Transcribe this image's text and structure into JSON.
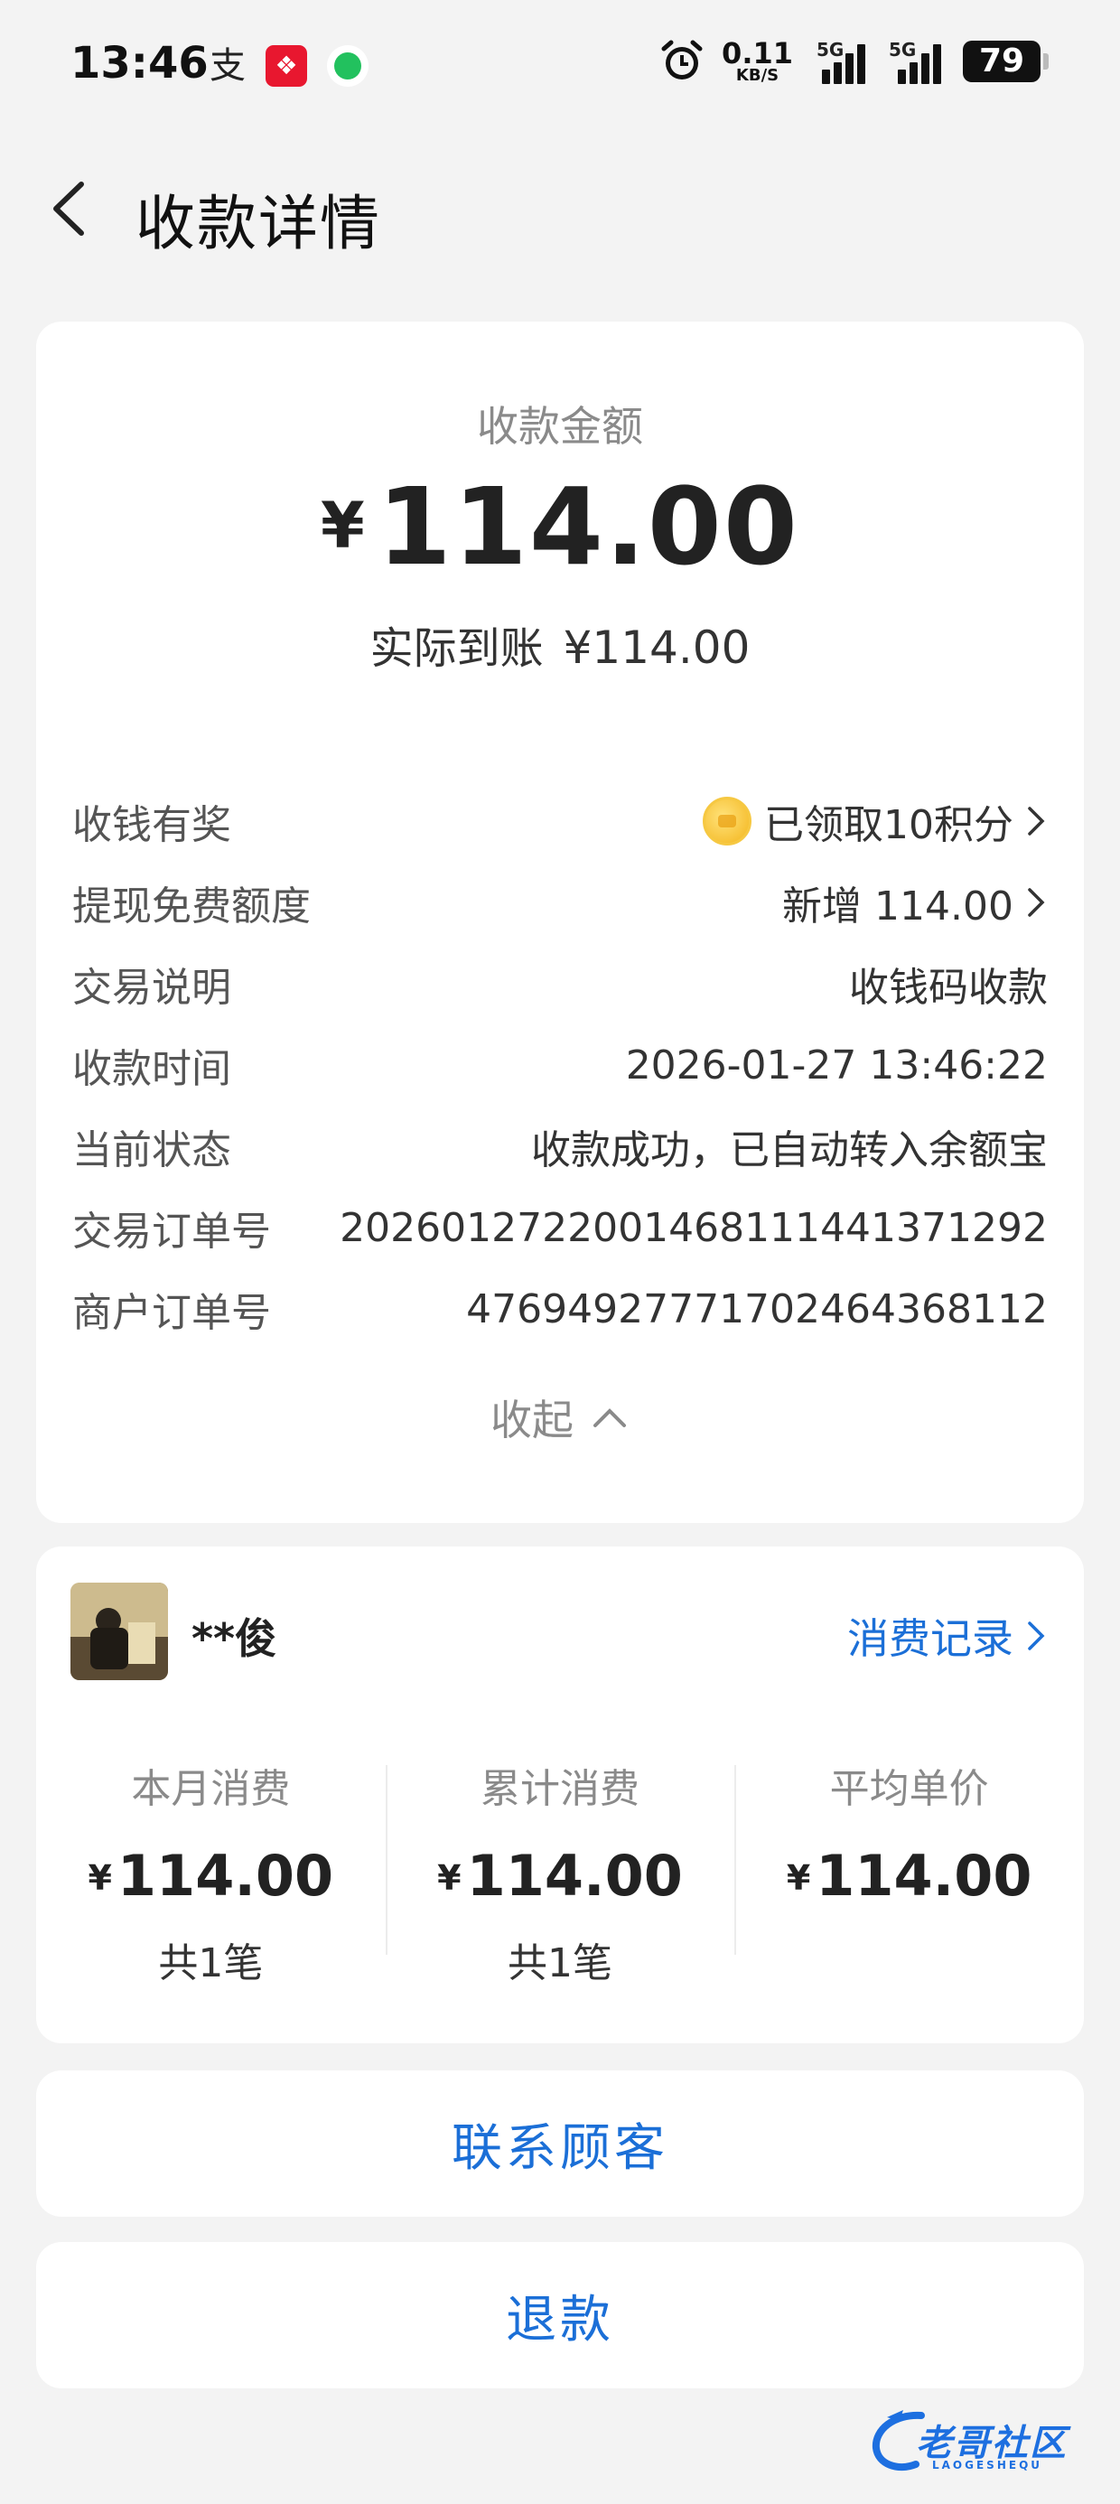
{
  "status_bar": {
    "time": "13:46",
    "net_speed_value": "0.11",
    "net_speed_unit": "KB/S",
    "network_1": "5G",
    "network_2": "5G",
    "battery": "79",
    "icons": [
      "alipay-icon",
      "red-app-icon",
      "green-app-icon",
      "alarm-icon",
      "signal-icon",
      "battery-icon"
    ]
  },
  "header": {
    "title": "收款详情"
  },
  "amount": {
    "label": "收款金额",
    "currency": "¥",
    "value": "114.00",
    "actual_label": "实际到账",
    "actual_value": "¥114.00"
  },
  "details": {
    "rows": [
      {
        "label": "收钱有奖",
        "value": "已领取10积分"
      },
      {
        "label": "提现免费额度",
        "value": "新增 114.00"
      },
      {
        "label": "交易说明",
        "value": "收钱码收款"
      },
      {
        "label": "收款时间",
        "value": "2026-01-27 13:46:22"
      },
      {
        "label": "当前状态",
        "value": "收款成功，已自动转入余额宝"
      },
      {
        "label": "交易订单号",
        "value": "2026012722001468111441371292"
      },
      {
        "label": "商户订单号",
        "value": "476949277717024643681​12"
      }
    ],
    "collapse_label": "收起"
  },
  "customer": {
    "name": "**俊",
    "record_link": "消费记录",
    "stats": [
      {
        "label": "本月消费",
        "currency": "¥",
        "value": "114.00",
        "count": "共1笔"
      },
      {
        "label": "累计消费",
        "currency": "¥",
        "value": "114.00",
        "count": "共1笔"
      },
      {
        "label": "平均单价",
        "currency": "¥",
        "value": "114.00",
        "count": ""
      }
    ]
  },
  "actions": {
    "contact_label": "联系顾客",
    "refund_label": "退款"
  },
  "watermark": {
    "text": "老哥社区",
    "sub": "LAOGESHEQU"
  },
  "colors": {
    "link_blue": "#1b6fd7",
    "background": "#f3f3f3"
  }
}
